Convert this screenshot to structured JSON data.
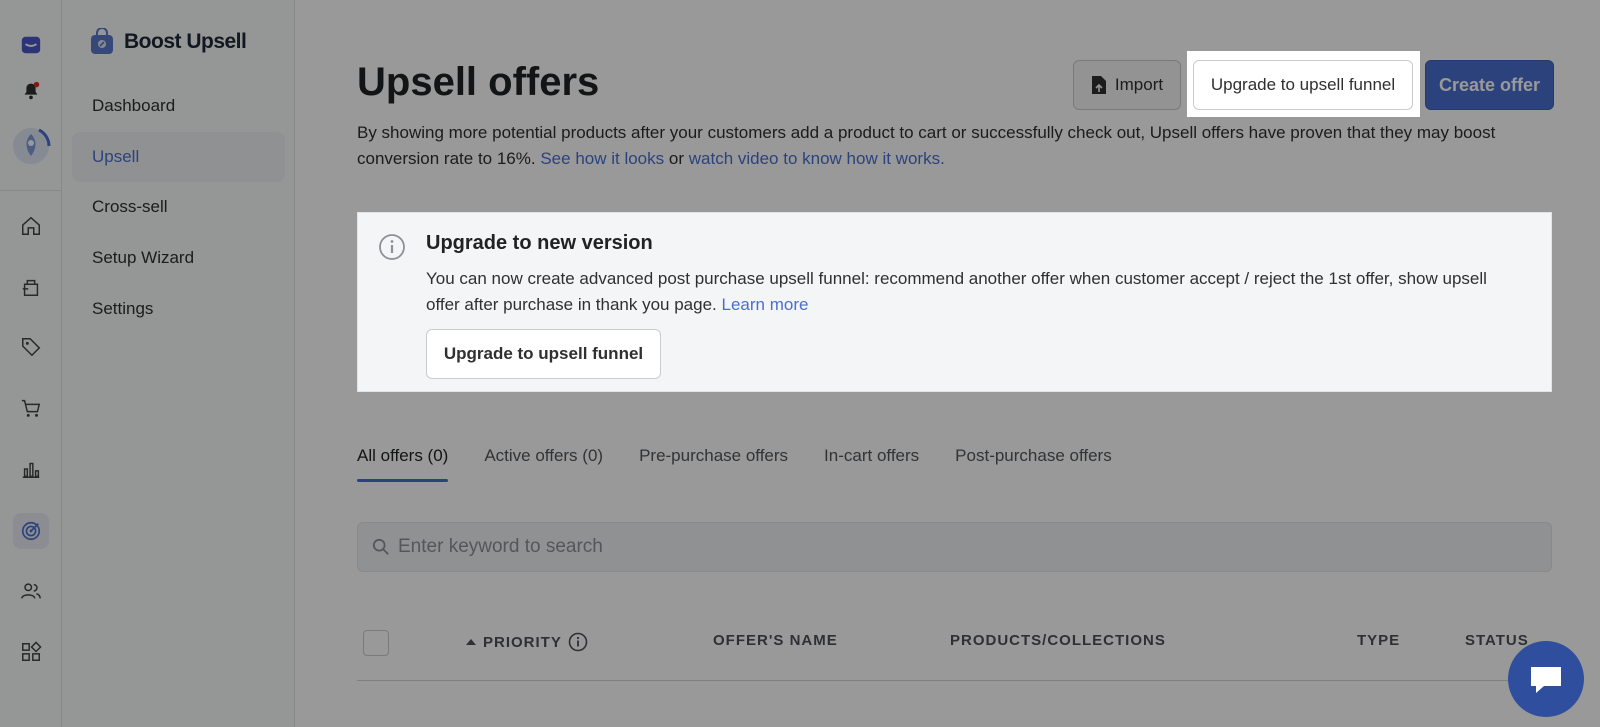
{
  "app": {
    "name": "Boost Upsell"
  },
  "rail": {
    "icons": [
      "app-logo-icon",
      "bell-icon",
      "rocket-avatar-icon",
      "home-icon",
      "orders-icon",
      "tag-icon",
      "cart-icon",
      "analytics-icon",
      "target-icon",
      "customers-icon",
      "apps-icon"
    ]
  },
  "sidebar": {
    "items": [
      {
        "label": "Dashboard"
      },
      {
        "label": "Upsell"
      },
      {
        "label": "Cross-sell"
      },
      {
        "label": "Setup Wizard"
      },
      {
        "label": "Settings"
      }
    ],
    "active": "Upsell"
  },
  "header": {
    "title": "Upsell offers",
    "import_label": "Import",
    "upgrade_label": "Upgrade to upsell funnel",
    "create_label": "Create offer"
  },
  "description": {
    "text": "By showing more potential products after your customers add a product to cart or successfully check out, Upsell offers have proven that they may boost conversion rate to 16%.",
    "link1": "See how it looks",
    "or": "or",
    "link2": "watch video to know how it works."
  },
  "banner": {
    "title": "Upgrade to new version",
    "text": "You can now create advanced post purchase upsell funnel: recommend another offer when customer accept / reject the 1st offer, show upsell offer after purchase in thank you page.",
    "learn_more": "Learn more",
    "button_label": "Upgrade to upsell funnel"
  },
  "tabs": [
    {
      "label": "All offers (0)"
    },
    {
      "label": "Active offers (0)"
    },
    {
      "label": "Pre-purchase offers"
    },
    {
      "label": "In-cart offers"
    },
    {
      "label": "Post-purchase offers"
    }
  ],
  "search": {
    "placeholder": "Enter keyword to search"
  },
  "table": {
    "columns": [
      "PRIORITY",
      "OFFER'S NAME",
      "PRODUCTS/COLLECTIONS",
      "TYPE",
      "STATUS"
    ]
  },
  "colors": {
    "accent": "#4a6fd0",
    "overlay": "rgba(0,0,0,0.40)"
  }
}
